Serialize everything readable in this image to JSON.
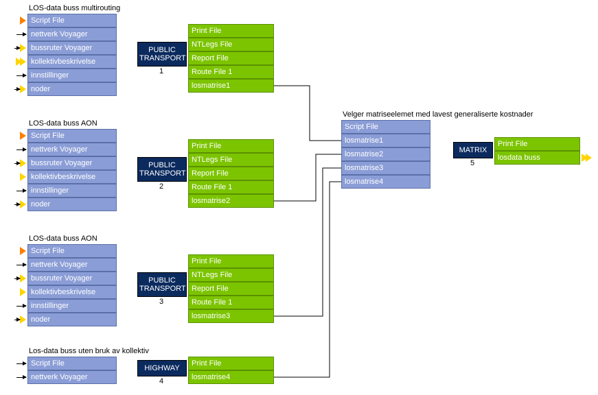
{
  "groups": {
    "g1": {
      "title": "LOS-data buss multirouting"
    },
    "g2": {
      "title": "LOS-data buss AON"
    },
    "g3": {
      "title": "LOS-data buss AON"
    },
    "g4": {
      "title": "Los-data buss uten bruk av kollektiv"
    },
    "g5": {
      "title": "Velger matriseelemet med lavest generaliserte kostnader"
    }
  },
  "inputs_full": {
    "i0": "Script File",
    "i1": "nettverk Voyager",
    "i2": "bussruter Voyager",
    "i3": "kollektivbeskrivelse",
    "i4": "innstillinger",
    "i5": "noder"
  },
  "inputs_hw": {
    "i0": "Script File",
    "i1": "nettverk Voyager"
  },
  "outputs_pt": {
    "o0": "Print File",
    "o1": "NTLegs File",
    "o2": "Report File",
    "o3": "Route File 1"
  },
  "pt1_out4": "losmatrise1",
  "pt2_out4": "losmatrise2",
  "pt3_out4": "losmatrise3",
  "hw_out0": "Print File",
  "hw_out1": "losmatrise4",
  "nodes": {
    "pt": "PUBLIC TRANSPORT",
    "hw": "HIGHWAY",
    "mx": "MATRIX",
    "n1": "1",
    "n2": "2",
    "n3": "3",
    "n4": "4",
    "n5": "5"
  },
  "mx_in": {
    "i0": "Script File",
    "i1": "losmatrise1",
    "i2": "losmatrise2",
    "i3": "losmatrise3",
    "i4": "losmatrise4"
  },
  "mx_out": {
    "o0": "Print File",
    "o1": "losdata buss"
  }
}
